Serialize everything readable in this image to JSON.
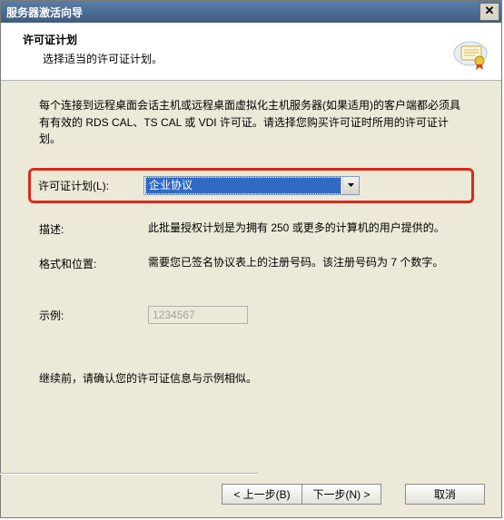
{
  "window": {
    "title": "服务器激活向导"
  },
  "header": {
    "title": "许可证计划",
    "subtitle": "选择适当的许可证计划。"
  },
  "content": {
    "intro": "每个连接到远程桌面会话主机或远程桌面虚拟化主机服务器(如果适用)的客户端都必须具有有效的 RDS CAL、TS CAL 或 VDI 许可证。请选择您购买许可证时所用的许可证计划。",
    "license_plan_label": "许可证计划(L):",
    "license_plan_value": "企业协议",
    "desc_label": "描述:",
    "desc_value": "此批量授权计划是为拥有 250 或更多的计算机的用户提供的。",
    "format_label": "格式和位置:",
    "format_value": "需要您已签名协议表上的注册号码。该注册号码为 7 个数字。",
    "example_label": "示例:",
    "example_value": "1234567",
    "confirm": "继续前，请确认您的许可证信息与示例相似。"
  },
  "buttons": {
    "back": "< 上一步(B)",
    "next": "下一步(N) >",
    "cancel": "取消"
  }
}
